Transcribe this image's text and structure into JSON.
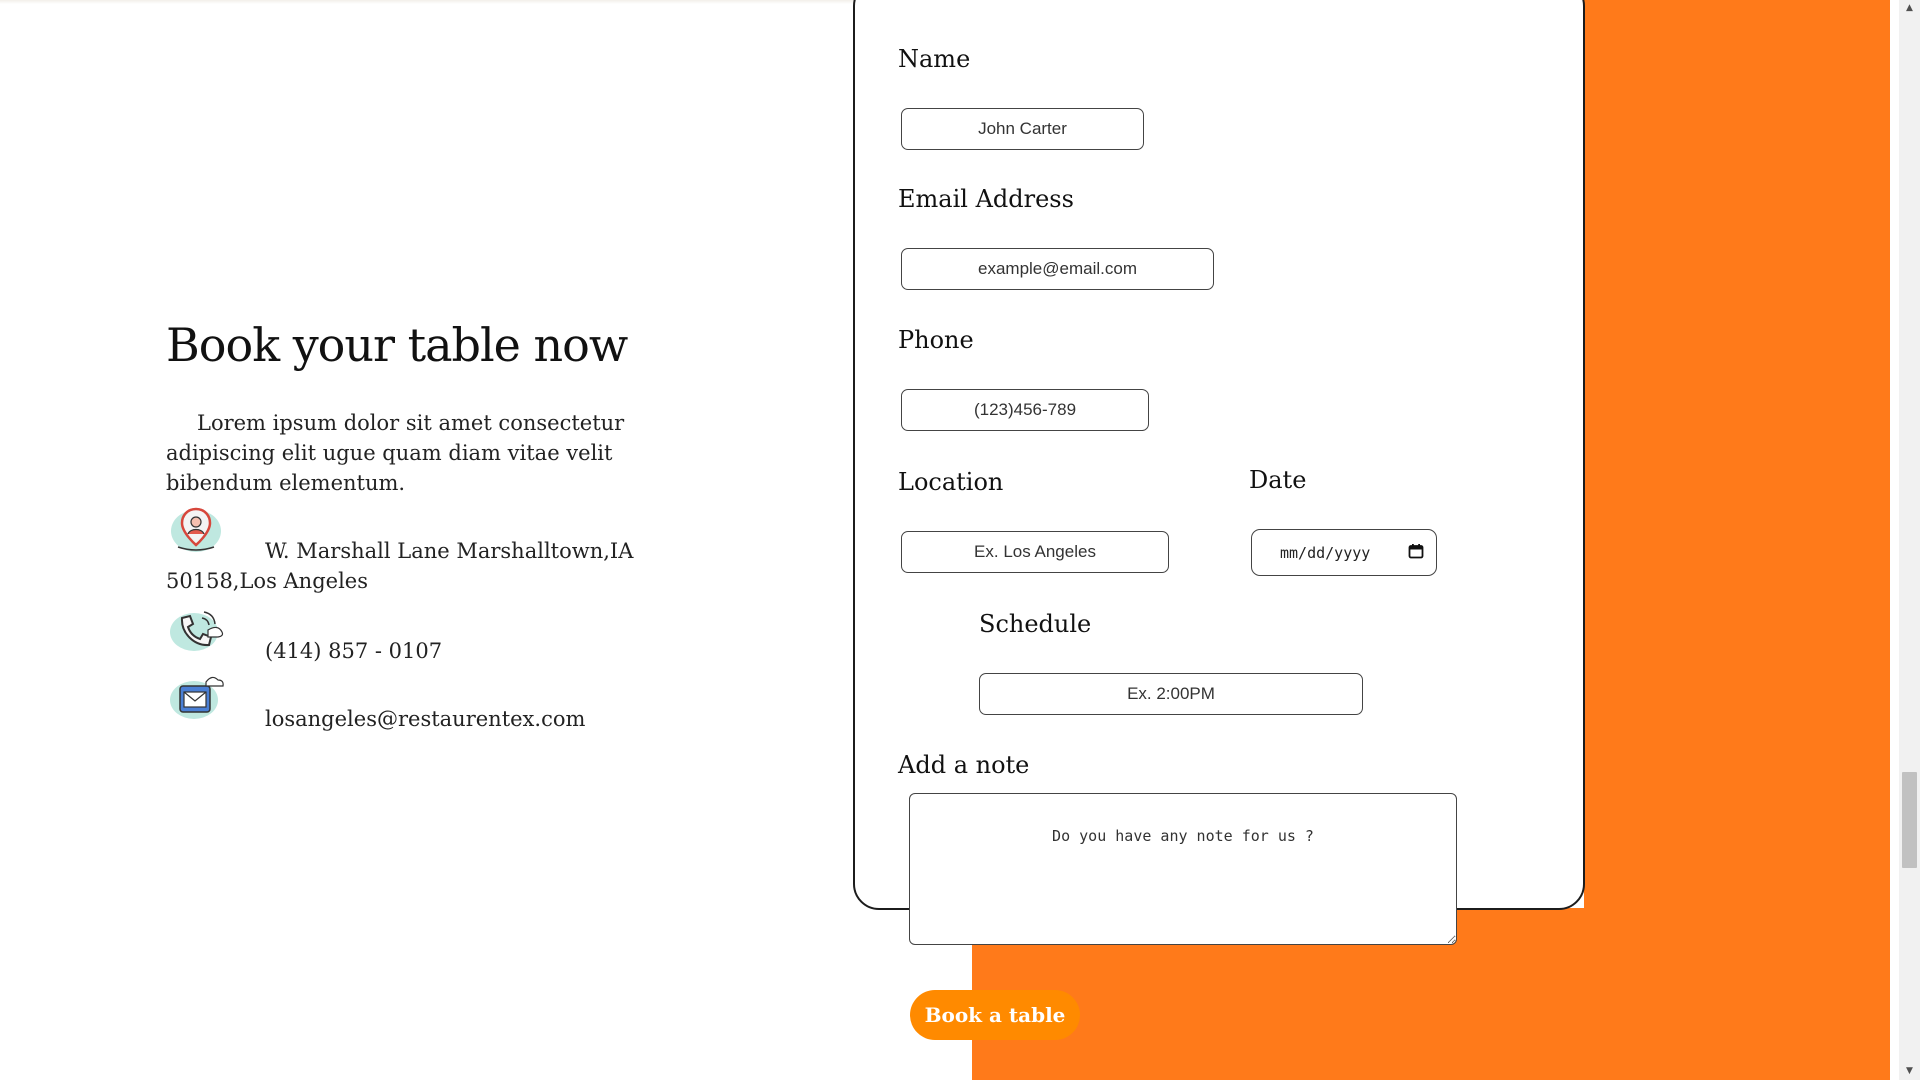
{
  "colors": {
    "accent_orange": "#FF7A1A",
    "button_orange": "#FF8A00"
  },
  "left": {
    "heading": "Book your table now",
    "intro": "Lorem ipsum dolor sit amet consectetur adipiscing elit ugue quam diam vitae velit bibendum elementum.",
    "address": "W. Marshall Lane Marshalltown,IA 50158,Los Angeles",
    "phone": "(414) 857 - 0107",
    "email": "losangeles@restaurentex.com",
    "icons": [
      "location-pin-icon",
      "phone-icon",
      "envelope-icon"
    ]
  },
  "form": {
    "name_label": "Name",
    "name_placeholder": "John Carter",
    "email_label": "Email Address",
    "email_placeholder": "example@email.com",
    "phone_label": "Phone",
    "phone_placeholder": "(123)456-789",
    "location_label": "Location",
    "location_placeholder": "Ex. Los Angeles",
    "date_label": "Date",
    "date_placeholder": "mm/dd/yyyy",
    "schedule_label": "Schedule",
    "schedule_placeholder": "Ex. 2:00PM",
    "note_label": "Add a note",
    "note_placeholder": "Do you have any note for us ?",
    "submit_label": "Book a table"
  }
}
